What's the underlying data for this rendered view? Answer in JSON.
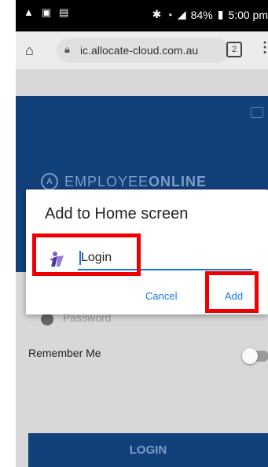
{
  "status_bar": {
    "battery": "84%",
    "time": "5:00 pm"
  },
  "browser": {
    "url": "ic.allocate-cloud.com.au",
    "tab_count": "2"
  },
  "page": {
    "logo_part1": "EMPLOYEE",
    "logo_part2": "ONLINE",
    "password_placeholder": "Password",
    "remember_me": "Remember Me",
    "login_button": "LOGIN"
  },
  "dialog": {
    "title": "Add to Home screen",
    "name_value": "Login",
    "cancel_label": "Cancel",
    "add_label": "Add"
  },
  "colors": {
    "brand_blue": "#12407a",
    "accent": "#1a73e8",
    "highlight": "#ee0000"
  }
}
